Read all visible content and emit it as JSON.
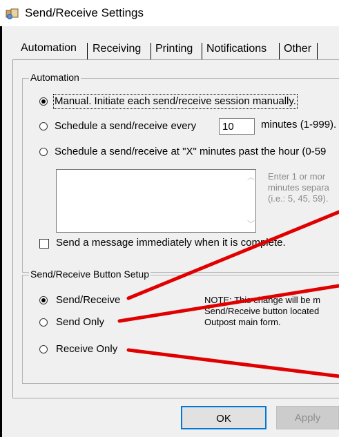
{
  "window": {
    "title": "Send/Receive Settings"
  },
  "tabs": [
    {
      "label": "Automation",
      "selected": true
    },
    {
      "label": "Receiving",
      "selected": false
    },
    {
      "label": "Printing",
      "selected": false
    },
    {
      "label": "Notifications",
      "selected": false
    },
    {
      "label": "Other",
      "selected": false
    }
  ],
  "automation": {
    "legend": "Automation",
    "manual_label": "Manual.  Initiate each send/receive session manually.",
    "manual_selected": true,
    "schedule_every_label": "Schedule a send/receive every",
    "schedule_every_value": "10",
    "schedule_every_suffix": "minutes (1-999).",
    "schedule_past_label": "Schedule a send/receive at \"X\" minutes past the hour (0-59",
    "minutes_list_value": "",
    "hint_line1": "Enter 1 or mor",
    "hint_line2": "minutes separa",
    "hint_line3": "(i.e.: 5, 45, 59).",
    "send_immediately_label": "Send a message immediately when it is complete.",
    "send_immediately_checked": false
  },
  "button_setup": {
    "legend": "Send/Receive Button Setup",
    "options": [
      {
        "label": "Send/Receive",
        "selected": true
      },
      {
        "label": "Send Only",
        "selected": false
      },
      {
        "label": "Receive Only",
        "selected": false
      }
    ],
    "note_line1": "NOTE:  This change will be m",
    "note_line2": "Send/Receive button located",
    "note_line3": "Outpost main form."
  },
  "buttons": {
    "ok": "OK",
    "apply": "Apply"
  },
  "colors": {
    "annotation": "#e00000",
    "accent": "#0078d7"
  },
  "icons": {
    "window": "app-window-icon"
  }
}
